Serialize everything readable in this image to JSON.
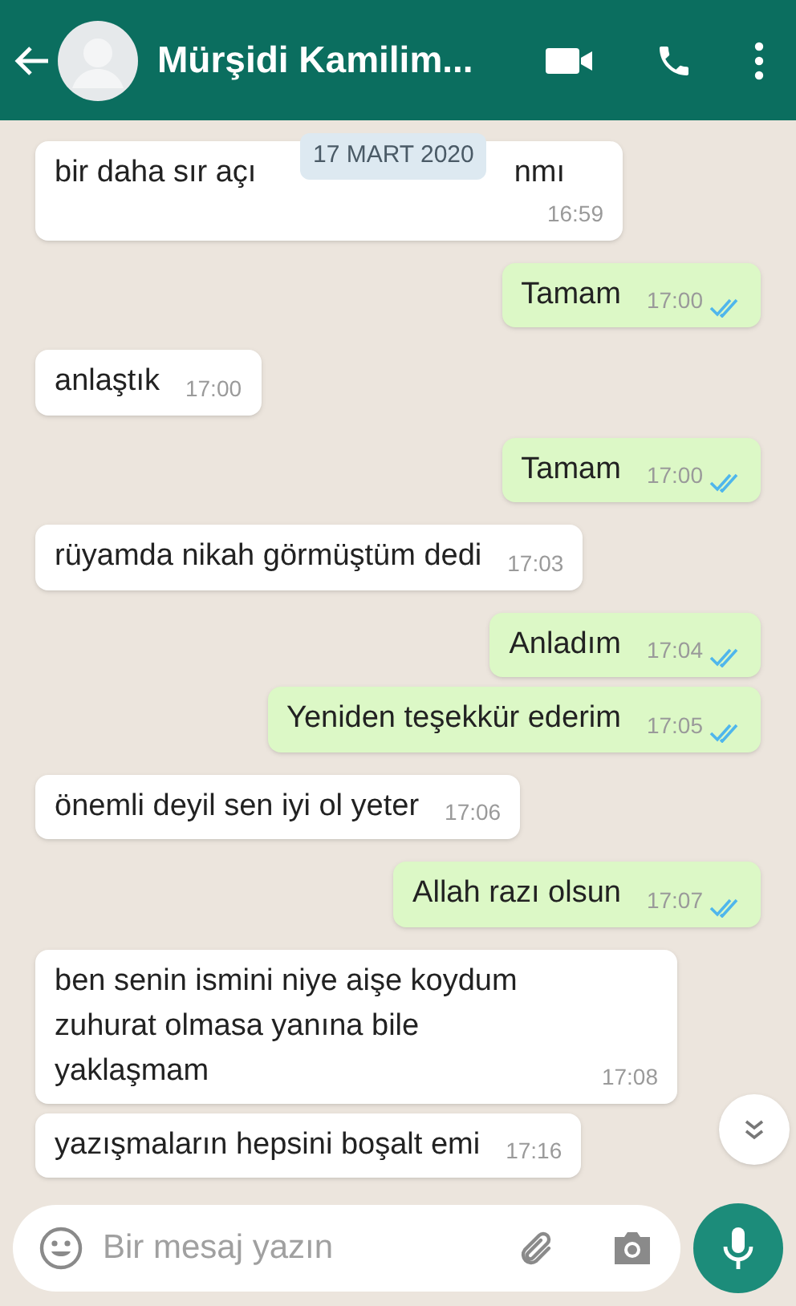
{
  "header": {
    "contact_name": "Mürşidi Kamilim..."
  },
  "date_chip": "17 MART 2020",
  "messages": [
    {
      "kind": "in",
      "text_parts": [
        "bir daha sır açı",
        "nmı"
      ],
      "time": "16:59"
    },
    {
      "kind": "out",
      "text": "Tamam",
      "time": "17:00",
      "read": true
    },
    {
      "kind": "in",
      "text": "anlaştık",
      "time": "17:00"
    },
    {
      "kind": "out",
      "text": "Tamam",
      "time": "17:00",
      "read": true
    },
    {
      "kind": "in",
      "text": "rüyamda nikah görmüştüm dedi",
      "time": "17:03"
    },
    {
      "kind": "out",
      "text": "Anladım",
      "time": "17:04",
      "read": true
    },
    {
      "kind": "out",
      "text": "Yeniden teşekkür ederim",
      "time": "17:05",
      "read": true
    },
    {
      "kind": "in",
      "text": "önemli deyil sen iyi ol yeter",
      "time": "17:06"
    },
    {
      "kind": "out",
      "text": "Allah razı olsun",
      "time": "17:07",
      "read": true
    },
    {
      "kind": "in",
      "text": "ben senin ismini niye aişe koydum zuhurat olmasa yanına bile yaklaşmam",
      "time": "17:08"
    },
    {
      "kind": "in",
      "text": "yazışmaların hepsini boşalt emi",
      "time": "17:16"
    }
  ],
  "composer": {
    "placeholder": "Bir mesaj yazın"
  }
}
